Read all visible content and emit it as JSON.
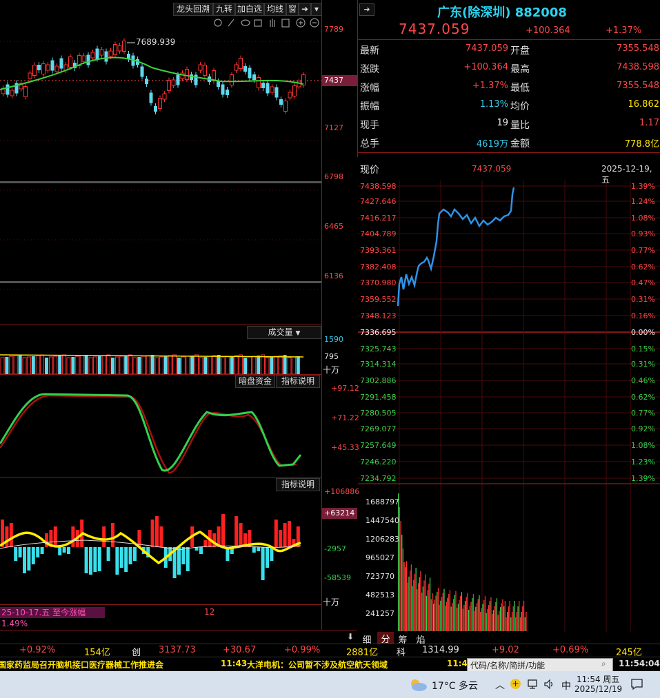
{
  "toolbar": {
    "buttons": [
      "龙头回溯",
      "九转",
      "加白选",
      "均线",
      "窗"
    ],
    "icons": [
      "settings-icon",
      "draw-icon",
      "eye-icon",
      "basket-icon",
      "hand-icon",
      "zoom-in-icon",
      "zoom-out-icon"
    ]
  },
  "kline": {
    "peak_label": "7689.939",
    "price_axis": [
      "7789",
      "7437",
      "7127",
      "6798",
      "6465",
      "6136"
    ]
  },
  "volume_panel": {
    "selector": "成交量",
    "axis": [
      "1590",
      "795",
      "十万"
    ]
  },
  "kdj_panel": {
    "btn_hidden_funds": "暗盘资金",
    "btn_explain": "指标说明",
    "axis": [
      "+97.12",
      "+71.22",
      "+45.33"
    ]
  },
  "macd_panel": {
    "btn_explain": "指标说明",
    "axis": [
      "+106886",
      "+63214",
      "-2957",
      "-58539",
      "十万"
    ],
    "footer_note": "25-10-17.五 至今涨幅1.49%",
    "footer_num": "12"
  },
  "quote": {
    "title": "广东(除深圳) 882008",
    "price": "7437.059",
    "change": "+100.364",
    "change_pct": "+1.37%",
    "rows": [
      {
        "k1": "最新",
        "v1": "7437.059",
        "c1": "red",
        "k2": "开盘",
        "v2": "7355.548",
        "c2": "red"
      },
      {
        "k1": "涨跌",
        "v1": "+100.364",
        "c1": "red",
        "k2": "最高",
        "v2": "7438.598",
        "c2": "red"
      },
      {
        "k1": "涨幅",
        "v1": "+1.37%",
        "c1": "red",
        "k2": "最低",
        "v2": "7355.548",
        "c2": "red"
      },
      {
        "k1": "振幅",
        "v1": "1.13%",
        "c1": "cyan",
        "k2": "均价",
        "v2": "16.862",
        "c2": "yellow"
      },
      {
        "k1": "现手",
        "v1": "19",
        "c1": "white",
        "k2": "量比",
        "v2": "1.17",
        "c2": "red"
      },
      {
        "k1": "总手",
        "v1": "4619万",
        "c1": "cyan",
        "k2": "金额",
        "v2": "778.8亿",
        "c2": "yellow"
      }
    ],
    "now_label": "现价",
    "now_price": "7437.059",
    "date": "2025-12-19,五"
  },
  "intraday": {
    "left_axis": [
      "7438.598",
      "7427.646",
      "7416.217",
      "7404.789",
      "7393.361",
      "7382.408",
      "7370.980",
      "7359.552",
      "7348.123",
      "7336.695",
      "7325.743",
      "7314.314",
      "7302.886",
      "7291.458",
      "7280.505",
      "7269.077",
      "7257.649",
      "7246.220",
      "7234.792"
    ],
    "right_axis": [
      "1.39%",
      "1.24%",
      "1.08%",
      "0.93%",
      "0.77%",
      "0.62%",
      "0.47%",
      "0.31%",
      "0.16%",
      "0.00%",
      "0.15%",
      "0.31%",
      "0.46%",
      "0.62%",
      "0.77%",
      "0.92%",
      "1.08%",
      "1.23%",
      "1.39%"
    ],
    "vol_axis": [
      "1688797",
      "1447540",
      "1206283",
      "965027",
      "723770",
      "482513",
      "241257"
    ],
    "tabs": [
      "细",
      "分",
      "筹",
      "焰"
    ]
  },
  "bottom_bar": {
    "items": [
      {
        "text": "+0.92%",
        "color": "red"
      },
      {
        "text": "154亿",
        "color": "yellow"
      },
      {
        "text": "创",
        "color": "white"
      },
      {
        "text": "3137.73",
        "color": "red"
      },
      {
        "text": "+30.67",
        "color": "red"
      },
      {
        "text": "+0.99%",
        "color": "red"
      },
      {
        "text": "2881亿",
        "color": "yellow"
      },
      {
        "text": "科",
        "color": "white"
      },
      {
        "text": "1314.99",
        "color": "red"
      },
      {
        "text": "+9.02",
        "color": "red"
      },
      {
        "text": "+0.69%",
        "color": "red"
      },
      {
        "text": "245亿",
        "color": "yellow"
      }
    ]
  },
  "news": {
    "item1": "国家药监局召开脑机接口医疗器械工作推进会",
    "time2": "11:43",
    "item2": "大洋电机：公司暂不涉及航空航天领域",
    "time3": "11:4",
    "search_placeholder": "代码/名称/简拼/功能",
    "clock": "11:54:04"
  },
  "taskbar": {
    "weather": "17°C 多云",
    "ime": "中",
    "time": "11:54 周五",
    "date": "2025/12/19"
  }
}
